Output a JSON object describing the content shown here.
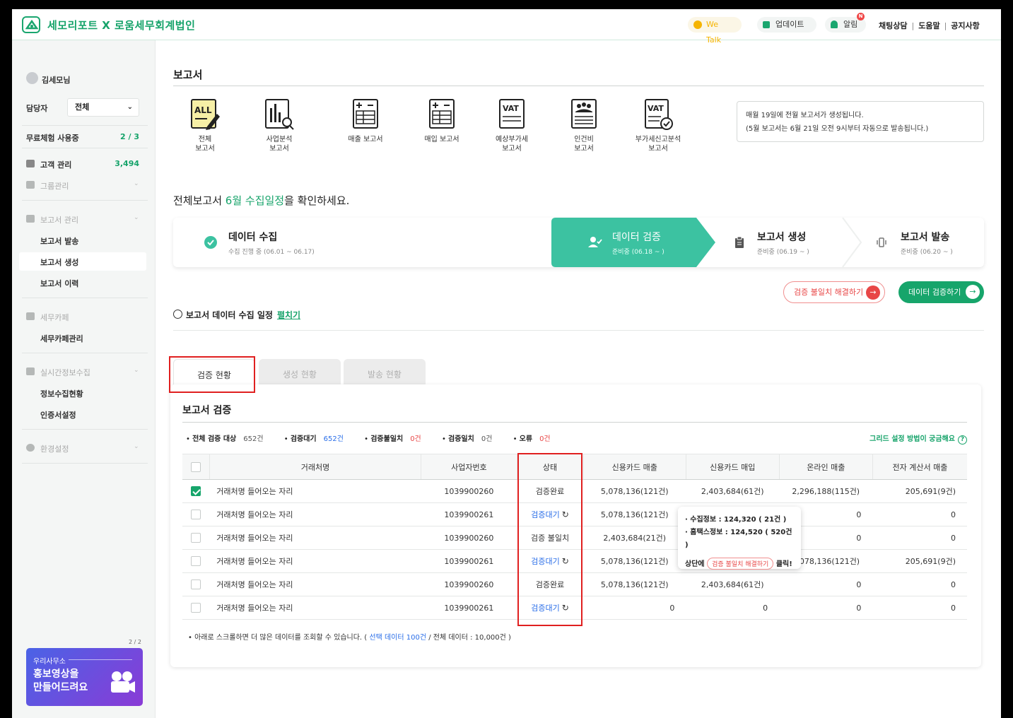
{
  "header": {
    "brand": "세모리포트 X 로움세무회계법인",
    "wetalk": "We Talk",
    "update": "업데이트",
    "alarm": "알림",
    "alarm_badge": "N",
    "links": [
      "채팅상담",
      "도움말",
      "공지사항"
    ]
  },
  "sidebar": {
    "user": "김세모님",
    "manager_label": "담당자",
    "manager_value": "전체",
    "trial_label": "무료체험 사용중",
    "trial_value": "2 / 3",
    "customer_label": "고객 관리",
    "customer_count": "3,494",
    "group_label": "그룹관리",
    "report_mgmt": "보고서 관리",
    "report_items": [
      "보고서 발송",
      "보고서 생성",
      "보고서 이력"
    ],
    "tax_cafe": "세무카페",
    "tax_cafe_items": [
      "세무카페관리"
    ],
    "realtime": "실시간정보수집",
    "realtime_items": [
      "정보수집현황",
      "인증서설정"
    ],
    "settings": "환경설정",
    "promo_count": "2 / 2",
    "promo_small": "우리사무소",
    "promo_line1": "홍보영상을",
    "promo_line2": "만들어드려요"
  },
  "page": {
    "title": "보고서",
    "reports": [
      {
        "label": "전체\n보고서"
      },
      {
        "label": "사업분석\n보고서"
      },
      {
        "label": "매출 보고서"
      },
      {
        "label": "매입 보고서"
      },
      {
        "label": "예상부가세\n보고서"
      },
      {
        "label": "인건비\n보고서"
      },
      {
        "label": "부가세신고분석\n보고서"
      }
    ],
    "notice_line1": "매월 19일에 전월 보고서가 생성됩니다.",
    "notice_line2": "(5월 보고서는 6월 21일 오전 9시부터 자동으로 발송됩니다.)",
    "schedule_prefix": "전체보고서 ",
    "schedule_highlight": "6월 수집일정",
    "schedule_suffix": "을 확인하세요."
  },
  "steps": [
    {
      "title": "데이터 수집",
      "sub": "수집 진행 중 (06.01 ~ 06.17)"
    },
    {
      "title": "데이터 검증",
      "sub": "준비중 (06.18 ~ )"
    },
    {
      "title": "보고서 생성",
      "sub": "준비중 (06.19 ~ )"
    },
    {
      "title": "보고서 발송",
      "sub": "준비중 (06.20 ~ )"
    }
  ],
  "buttons": {
    "resolve_mismatch": "검증 불일치 해결하기",
    "verify_data": "데이터 검증하기"
  },
  "schedule_link": {
    "label": "보고서 데이터 수집 일정",
    "link": "펼치기"
  },
  "tabs": [
    "검증 현황",
    "생성 현황",
    "발송 현황"
  ],
  "panel": {
    "title": "보고서 검증",
    "stats": [
      {
        "k": "전체 검증 대상",
        "v": "652건"
      },
      {
        "k": "검증대기",
        "v": "652건"
      },
      {
        "k": "검증불일치",
        "v": "0건"
      },
      {
        "k": "검증일치",
        "v": "0건"
      },
      {
        "k": "오류",
        "v": "0건"
      }
    ],
    "grid_help": "그리드 설정 방법이 궁금해요",
    "columns": [
      "거래처명",
      "사업자번호",
      "상태",
      "신용카드 매출",
      "신용카드 매입",
      "온라인 매출",
      "전자 계산서 매출"
    ],
    "rows": [
      {
        "name": "거래처명 들어오는 자리",
        "biz": "1039900260",
        "status": "검증완료",
        "card_sales": "5,078,136(121건)",
        "card_buy": "2,403,684(61건)",
        "online": "2,296,188(115건)",
        "einvoice": "205,691(9건)"
      },
      {
        "name": "거래처명 들어오는 자리",
        "biz": "1039900261",
        "status": "검증대기",
        "card_sales": "5,078,136(121건)",
        "card_buy": "",
        "online": "0",
        "einvoice": "0"
      },
      {
        "name": "거래처명 들어오는 자리",
        "biz": "1039900260",
        "status": "검증 불일치",
        "card_sales": "2,403,684(21건)",
        "card_buy": "",
        "online": "0",
        "einvoice": "0"
      },
      {
        "name": "거래처명 들어오는 자리",
        "biz": "1039900261",
        "status": "검증대기",
        "card_sales": "5,078,136(121건)",
        "card_buy": "",
        "online": "5,078,136(121건)",
        "einvoice": "205,691(9건)"
      },
      {
        "name": "거래처명 들어오는 자리",
        "biz": "1039900260",
        "status": "검증완료",
        "card_sales": "5,078,136(121건)",
        "card_buy": "2,403,684(61건)",
        "online": "0",
        "einvoice": "0"
      },
      {
        "name": "거래처명 들어오는 자리",
        "biz": "1039900261",
        "status": "검증대기",
        "card_sales": "0",
        "card_buy": "0",
        "online": "0",
        "einvoice": "0"
      }
    ],
    "tooltip": {
      "line1": "수집정보 : 124,320 ( 21건 )",
      "line2": "홈택스정보 : 124,520 ( 520건 )",
      "act_prefix": "상단에 ",
      "act_pill": "검증 불일치 해결하기",
      "act_suffix": " 클릭!"
    },
    "foot_prefix": "아래로 스크롤하면 더 많은 데이터를 조회할 수 있습니다. ( ",
    "foot_selected": "선택 데이터 100건",
    "foot_suffix": " / 전체 데이터 : 10,000건 )"
  },
  "colors": {
    "brand": "#16a36a",
    "active_step": "#3cc2a1",
    "error": "#e84646",
    "wait": "#2a6ee8"
  }
}
